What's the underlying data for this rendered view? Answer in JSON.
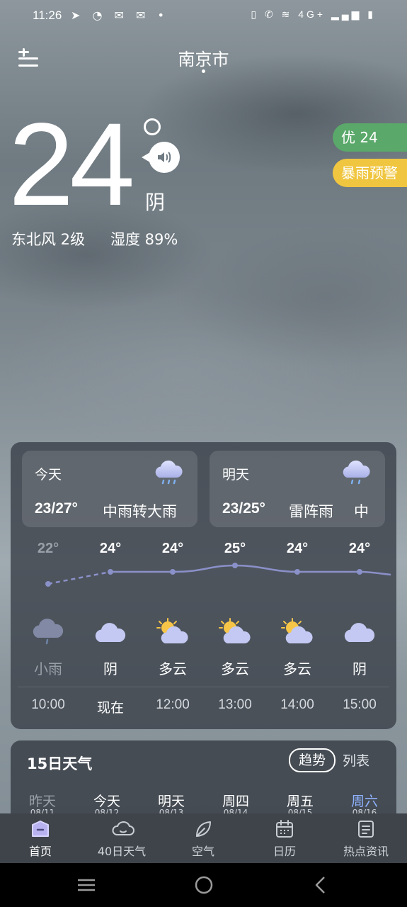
{
  "status_bar": {
    "time": "11:26",
    "left_icons": "➤ ◔ ✉ ✉ •",
    "network": "4G+"
  },
  "header": {
    "city": "南京市"
  },
  "current": {
    "temperature": "24",
    "condition": "阴",
    "wind": "东北风 2级",
    "humidity": "湿度 89%"
  },
  "badges": {
    "aqi": "优 24",
    "alert": "暴雨预警",
    "aqi_color": "#5aa86a",
    "alert_color": "#f0c640"
  },
  "day_cards": [
    {
      "label": "今天",
      "range": "23/27°",
      "condition": "中雨转大雨",
      "icon": "rain-cloud-icon"
    },
    {
      "label": "明天",
      "range": "23/25°",
      "condition": "雷阵雨",
      "condition2": "中",
      "icon": "rain-cloud-icon"
    }
  ],
  "hourly": [
    {
      "temp": "22°",
      "condition": "小雨",
      "time": "10:00",
      "icon": "rain-cloud-icon"
    },
    {
      "temp": "24°",
      "condition": "阴",
      "time": "现在",
      "icon": "cloud-icon"
    },
    {
      "temp": "24°",
      "condition": "多云",
      "time": "12:00",
      "icon": "partly-cloudy-icon"
    },
    {
      "temp": "25°",
      "condition": "多云",
      "time": "13:00",
      "icon": "partly-cloudy-icon"
    },
    {
      "temp": "24°",
      "condition": "多云",
      "time": "14:00",
      "icon": "partly-cloudy-icon"
    },
    {
      "temp": "24°",
      "condition": "阴",
      "time": "15:00",
      "icon": "cloud-icon"
    }
  ],
  "forecast15": {
    "title": "15日天气",
    "trend_label": "趋势",
    "list_label": "列表",
    "days": [
      {
        "label": "昨天",
        "date": "08/11"
      },
      {
        "label": "今天",
        "date": "08/12"
      },
      {
        "label": "明天",
        "date": "08/13"
      },
      {
        "label": "周四",
        "date": "08/14"
      },
      {
        "label": "周五",
        "date": "08/15"
      },
      {
        "label": "周六",
        "date": "08/16"
      }
    ]
  },
  "nav": [
    {
      "label": "首页",
      "icon": "home-icon"
    },
    {
      "label": "40日天气",
      "icon": "cloud-outline-icon"
    },
    {
      "label": "空气",
      "icon": "leaf-icon"
    },
    {
      "label": "日历",
      "icon": "calendar-icon"
    },
    {
      "label": "热点资讯",
      "icon": "news-icon"
    }
  ]
}
